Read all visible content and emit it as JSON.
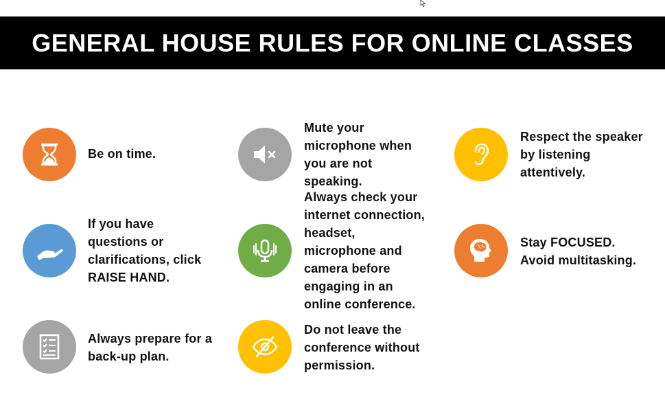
{
  "title": "GENERAL HOUSE RULES FOR ONLINE CLASSES",
  "colors": {
    "orange": "#ED7D31",
    "gray": "#A5A5A5",
    "yellow": "#FFC000",
    "blue": "#5B9BD5",
    "green": "#70AD47",
    "banner": "#000000"
  },
  "rules": [
    {
      "icon": "hourglass-icon",
      "color": "#ED7D31",
      "lines": [
        "Be on time."
      ]
    },
    {
      "icon": "raise-hand-icon",
      "color": "#5B9BD5",
      "lines": [
        "If you have",
        "questions or",
        "clarifications, click",
        "RAISE HAND."
      ]
    },
    {
      "icon": "checklist-icon",
      "color": "#A5A5A5",
      "lines": [
        "Always prepare for a",
        "back-up plan."
      ]
    },
    {
      "icon": "muted-speaker-icon",
      "color": "#A5A5A5",
      "lines": [
        "Mute your",
        "microphone when",
        "you are not",
        "speaking."
      ]
    },
    {
      "icon": "microphone-icon",
      "color": "#70AD47",
      "lines": [
        "Always check your",
        "internet connection,",
        "headset,",
        "microphone and",
        "camera before",
        "engaging in an",
        "online conference."
      ]
    },
    {
      "icon": "hidden-eye-icon",
      "color": "#FFC000",
      "lines": [
        "Do not leave the",
        "conference without",
        "permission."
      ]
    },
    {
      "icon": "ear-icon",
      "color": "#FFC000",
      "lines": [
        "Respect the speaker",
        "by listening",
        "attentively."
      ]
    },
    {
      "icon": "head-brain-icon",
      "color": "#ED7D31",
      "lines": [
        "Stay FOCUSED.",
        "Avoid multitasking."
      ]
    }
  ]
}
